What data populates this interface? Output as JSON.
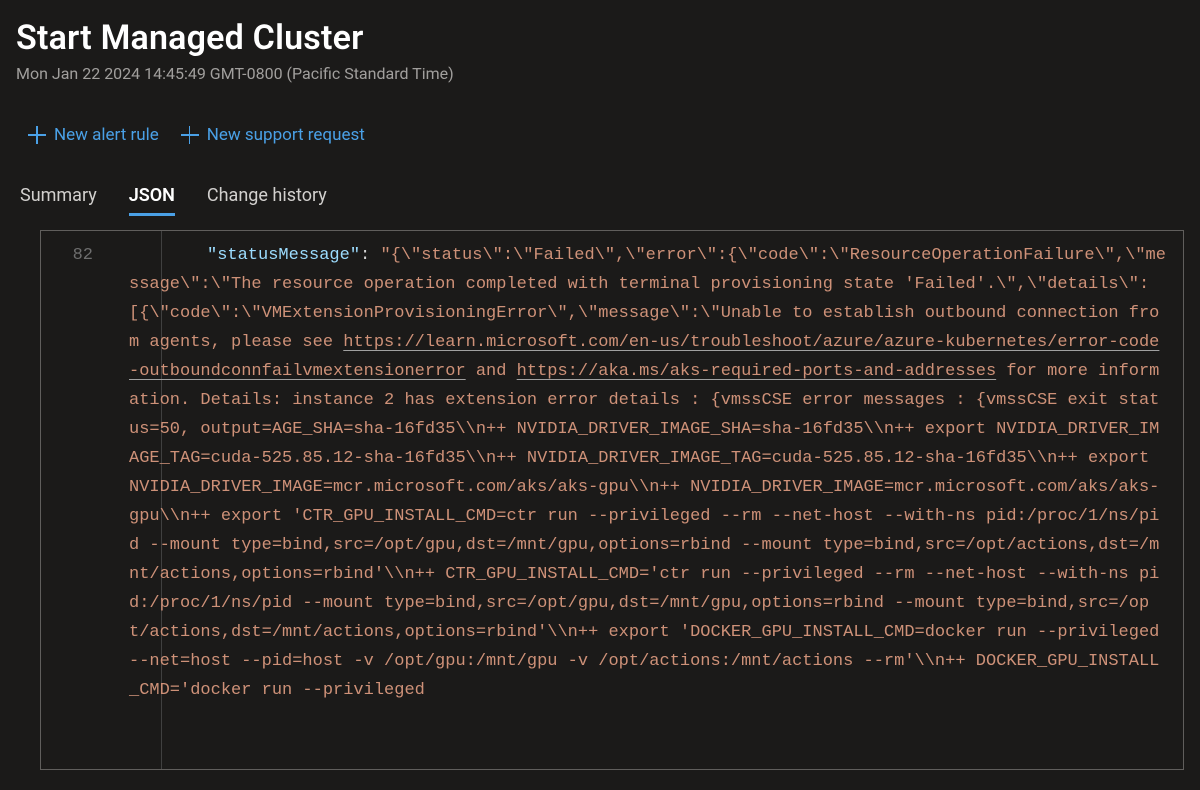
{
  "header": {
    "title": "Start Managed Cluster",
    "timestamp": "Mon Jan 22 2024 14:45:49 GMT-0800 (Pacific Standard Time)"
  },
  "toolbar": {
    "new_alert_label": "New alert rule",
    "new_support_label": "New support request"
  },
  "tabs": {
    "summary": "Summary",
    "json": "JSON",
    "change_history": "Change history",
    "active": "json"
  },
  "code": {
    "line_number": "82",
    "key": "\"statusMessage\"",
    "colon": ": ",
    "pre_link1": "\"{\\\"status\\\":\\\"Failed\\\",\\\"error\\\":{\\\"code\\\":\\\"ResourceOperationFailure\\\",\\\"message\\\":\\\"The resource operation completed with terminal provisioning state 'Failed'.\\\",\\\"details\\\":[{\\\"code\\\":\\\"VMExtensionProvisioningError\\\",\\\"message\\\":\\\"Unable to establish outbound connection from agents, please see ",
    "link1": "https://learn.microsoft.com/en-us/troubleshoot/azure/azure-kubernetes/error-code-outboundconnfailvmextensionerror",
    "between_links": " and ",
    "link2": "https://aka.ms/aks-required-ports-and-addresses",
    "post_link": " for more information. Details: instance 2 has extension error details : {vmssCSE error messages : {vmssCSE exit status=50, output=AGE_SHA=sha-16fd35\\\\n++ NVIDIA_DRIVER_IMAGE_SHA=sha-16fd35\\\\n++ export NVIDIA_DRIVER_IMAGE_TAG=cuda-525.85.12-sha-16fd35\\\\n++ NVIDIA_DRIVER_IMAGE_TAG=cuda-525.85.12-sha-16fd35\\\\n++ export NVIDIA_DRIVER_IMAGE=mcr.microsoft.com/aks/aks-gpu\\\\n++ NVIDIA_DRIVER_IMAGE=mcr.microsoft.com/aks/aks-gpu\\\\n++ export 'CTR_GPU_INSTALL_CMD=ctr run --privileged --rm --net-host --with-ns pid:/proc/1/ns/pid --mount type=bind,src=/opt/gpu,dst=/mnt/gpu,options=rbind --mount type=bind,src=/opt/actions,dst=/mnt/actions,options=rbind'\\\\n++ CTR_GPU_INSTALL_CMD='ctr run --privileged --rm --net-host --with-ns pid:/proc/1/ns/pid --mount type=bind,src=/opt/gpu,dst=/mnt/gpu,options=rbind --mount type=bind,src=/opt/actions,dst=/mnt/actions,options=rbind'\\\\n++ export 'DOCKER_GPU_INSTALL_CMD=docker run --privileged --net=host --pid=host -v /opt/gpu:/mnt/gpu -v /opt/actions:/mnt/actions --rm'\\\\n++ DOCKER_GPU_INSTALL_CMD='docker run --privileged"
  }
}
